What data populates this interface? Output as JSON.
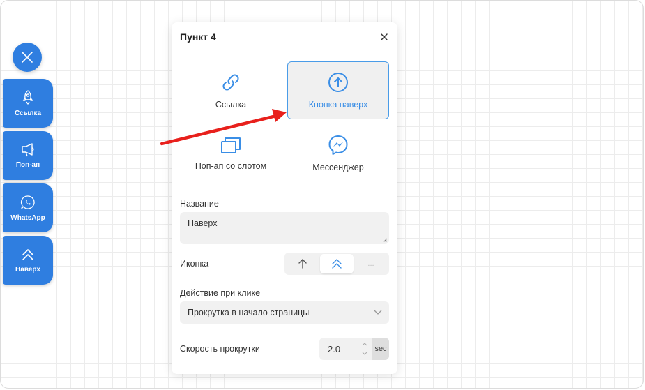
{
  "side_buttons": [
    {
      "label": "Ссылка",
      "icon": "rocket-icon"
    },
    {
      "label": "Поп-ап",
      "icon": "megaphone-icon"
    },
    {
      "label": "WhatsApp",
      "icon": "whatsapp-icon"
    },
    {
      "label": "Наверх",
      "icon": "double-chevron-up-icon"
    }
  ],
  "panel": {
    "title": "Пункт 4",
    "types": [
      {
        "label": "Ссылка",
        "icon": "link-icon"
      },
      {
        "label": "Кнопка наверх",
        "icon": "arrow-up-circle-icon",
        "selected": true
      },
      {
        "label": "Поп-ап со слотом",
        "icon": "windows-icon"
      },
      {
        "label": "Мессенджер",
        "icon": "messenger-icon"
      }
    ],
    "name_label": "Название",
    "name_value": "Наверх",
    "icon_label": "Иконка",
    "icon_options": [
      "arrow-up-icon",
      "double-chevron-up-icon",
      "..."
    ],
    "action_label": "Действие при клике",
    "action_value": "Прокрутка в начало страницы",
    "speed_label": "Скорость прокрутки",
    "speed_value": "2.0",
    "speed_unit": "sec"
  },
  "colors": {
    "accent": "#2f7ee0",
    "selected_border": "#4a9ce8",
    "annotation_arrow": "#e8201c"
  }
}
